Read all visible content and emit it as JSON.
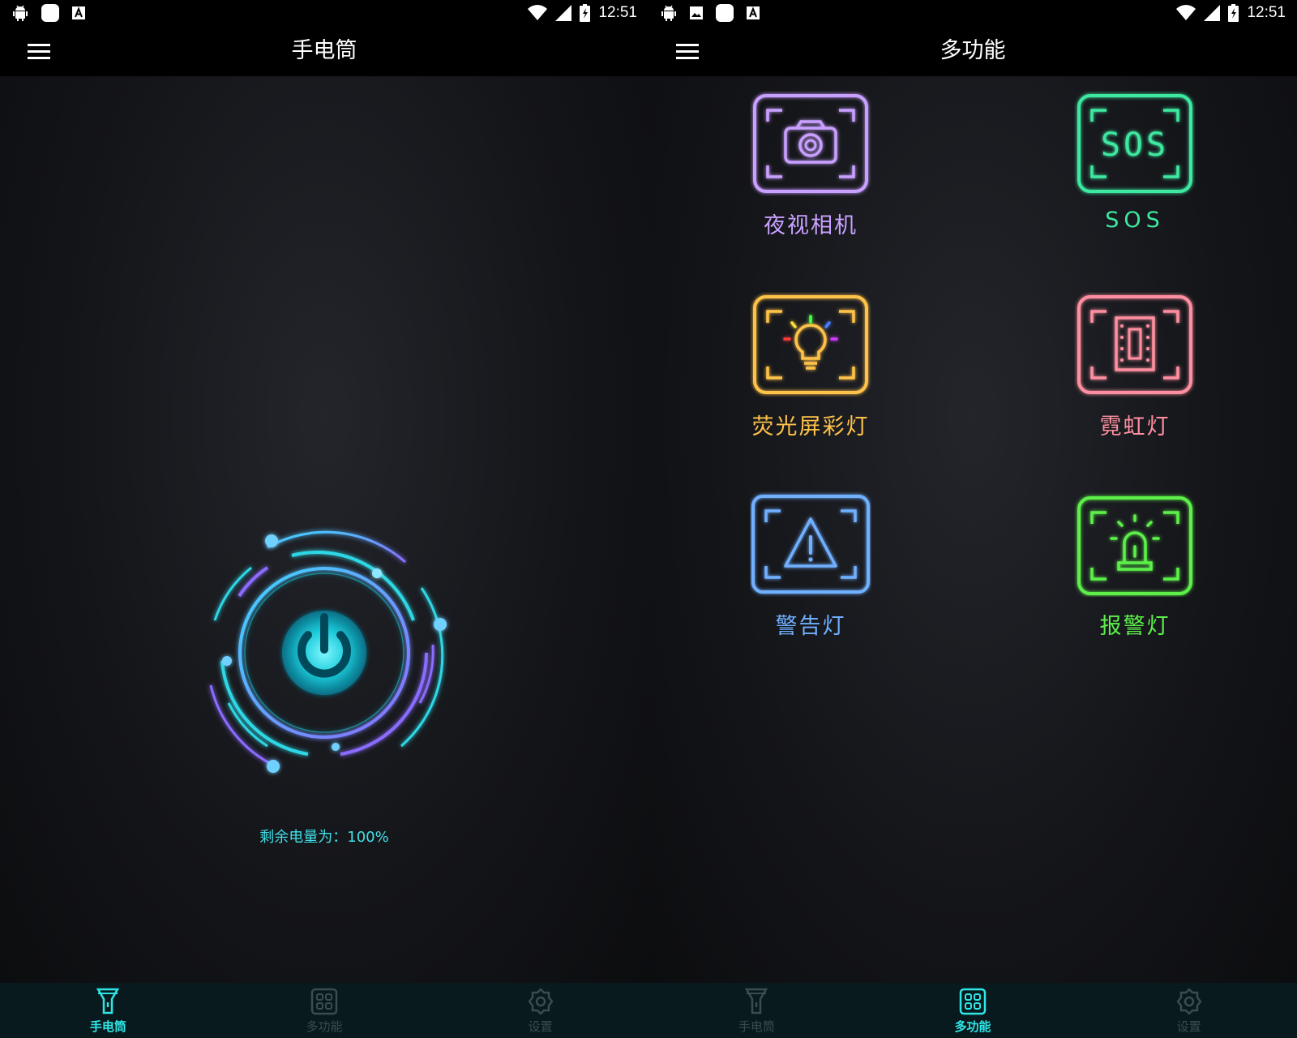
{
  "status_bar": {
    "time": "12:51"
  },
  "screens": [
    {
      "title": "手电筒",
      "battery_text": "剩余电量为：100%"
    },
    {
      "title": "多功能",
      "features": [
        {
          "label": "夜视相机",
          "color": "#c9a0ff",
          "icon": "camera-icon"
        },
        {
          "label": "SOS",
          "color": "#3ee8a0",
          "icon": "sos-icon",
          "icon_text": "SOS"
        },
        {
          "label": "荧光屏彩灯",
          "color": "#ffc24a",
          "icon": "lightbulb-icon"
        },
        {
          "label": "霓虹灯",
          "color": "#ff8fa0",
          "icon": "neon-tube-icon"
        },
        {
          "label": "警告灯",
          "color": "#6fb0ff",
          "icon": "warning-triangle-icon"
        },
        {
          "label": "报警灯",
          "color": "#5cf04a",
          "icon": "alarm-siren-icon"
        }
      ]
    }
  ],
  "bottom_nav": [
    {
      "label": "手电筒",
      "icon": "flashlight-icon"
    },
    {
      "label": "多功能",
      "icon": "grid-icon"
    },
    {
      "label": "设置",
      "icon": "gear-icon"
    }
  ],
  "colors": {
    "accent": "#2fe6e6",
    "nav_inactive": "#3c4b4e",
    "nav_background": "#081a1d"
  }
}
